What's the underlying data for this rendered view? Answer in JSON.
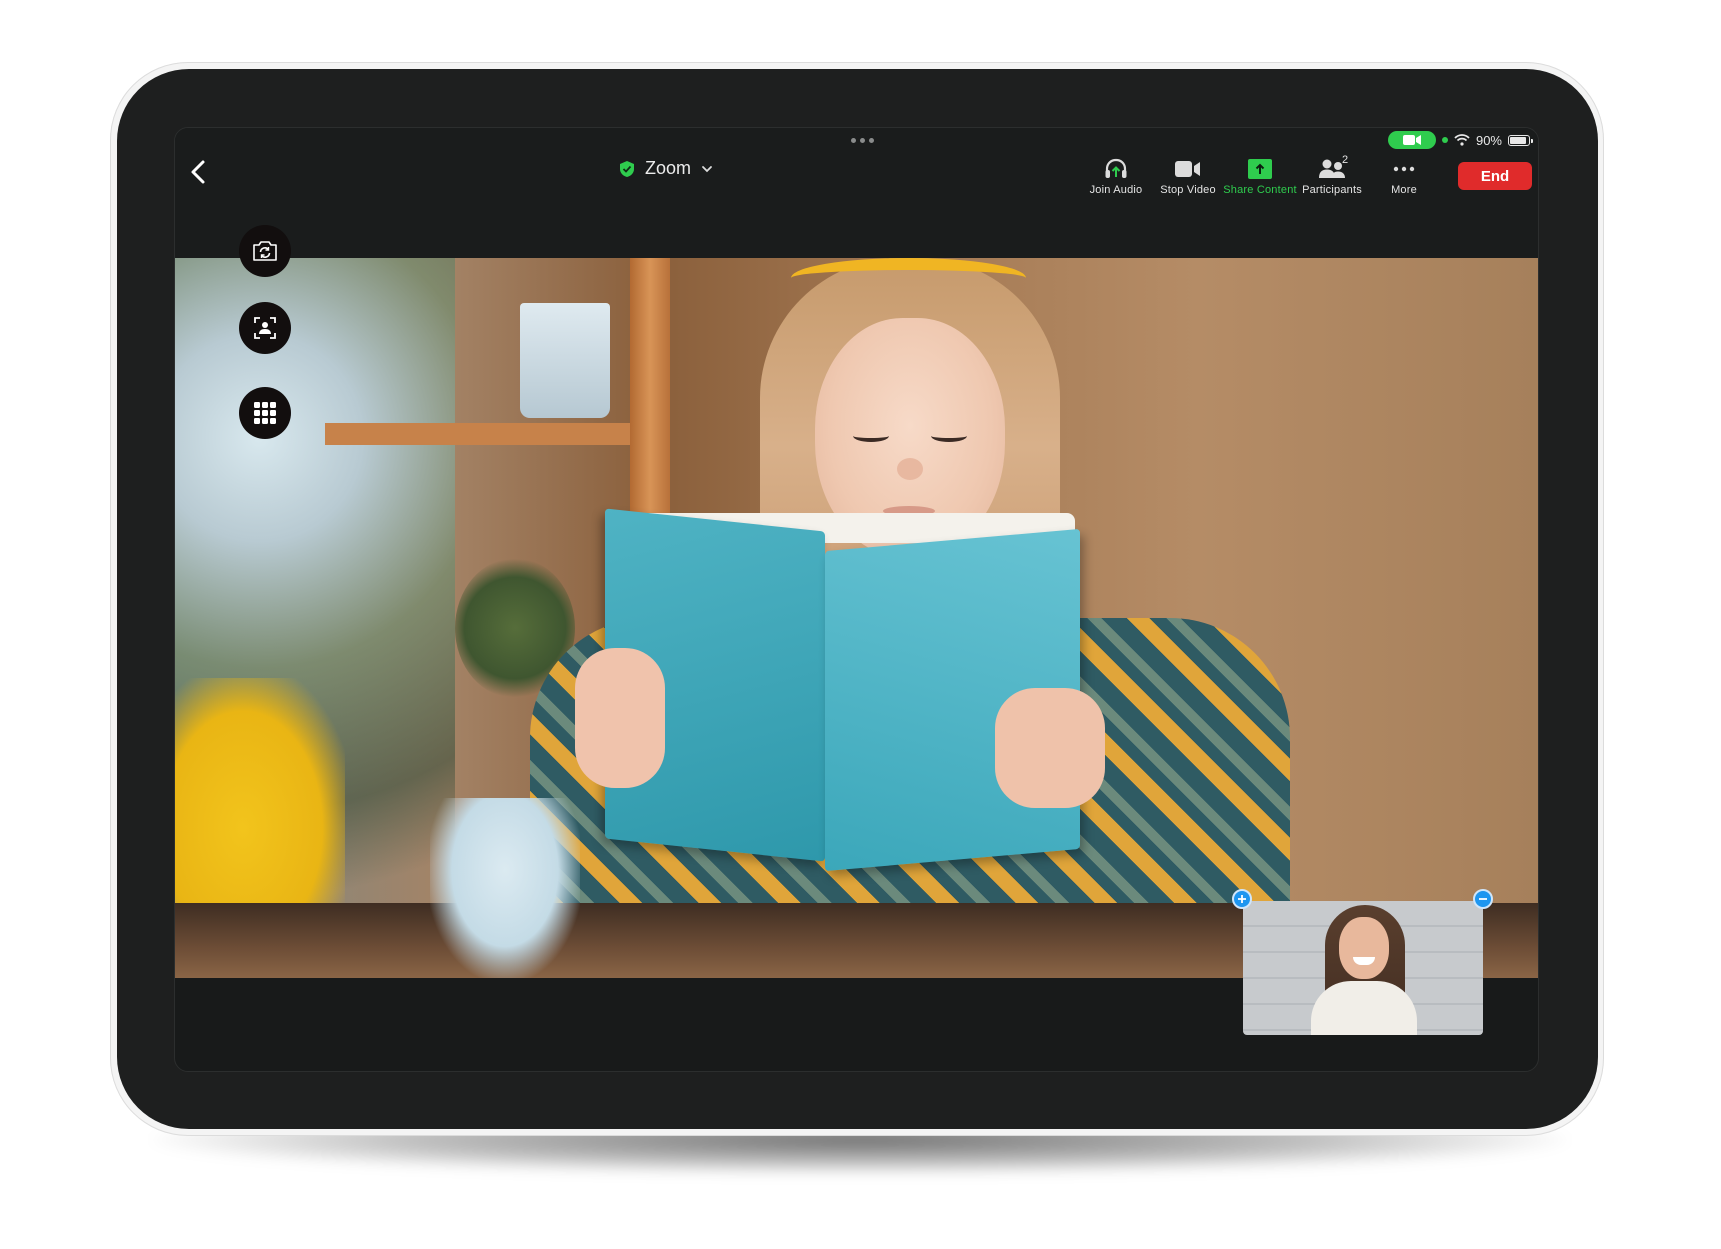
{
  "status_bar": {
    "camera_indicator": "video-camera-icon",
    "wifi": "wifi-icon",
    "battery_percent": "90%",
    "battery_level": 0.9
  },
  "header": {
    "meeting_title": "Zoom",
    "secure_icon": "green-shield-check-icon",
    "back_icon": "chevron-left-icon",
    "more_handle_icon": "three-dots-icon"
  },
  "toolbar": {
    "items": [
      {
        "label": "Join Audio",
        "icon": "headphones-icon",
        "active": false
      },
      {
        "label": "Stop Video",
        "icon": "video-camera-icon",
        "active": false
      },
      {
        "label": "Share Content",
        "icon": "share-upload-icon",
        "active": true
      },
      {
        "label": "Participants",
        "icon": "participants-icon",
        "badge": "2",
        "active": false
      },
      {
        "label": "More",
        "icon": "ellipsis-icon",
        "active": false
      }
    ],
    "end_label": "End"
  },
  "side_controls": [
    {
      "name": "switch-camera",
      "icon": "camera-rotate-icon"
    },
    {
      "name": "center-stage",
      "icon": "face-frame-icon"
    },
    {
      "name": "apps-grid",
      "icon": "grid-icon"
    }
  ],
  "main_video": {
    "description": "Girl reading a teal book"
  },
  "pip_video": {
    "description": "Smiling woman self-view",
    "expand_icon": "plus-icon",
    "collapse_icon": "minus-icon"
  },
  "colors": {
    "accent_green": "#2fcc4e",
    "end_red": "#e02b2b",
    "pip_control_blue": "#1e96f0",
    "screen_bg": "#181a1a"
  }
}
